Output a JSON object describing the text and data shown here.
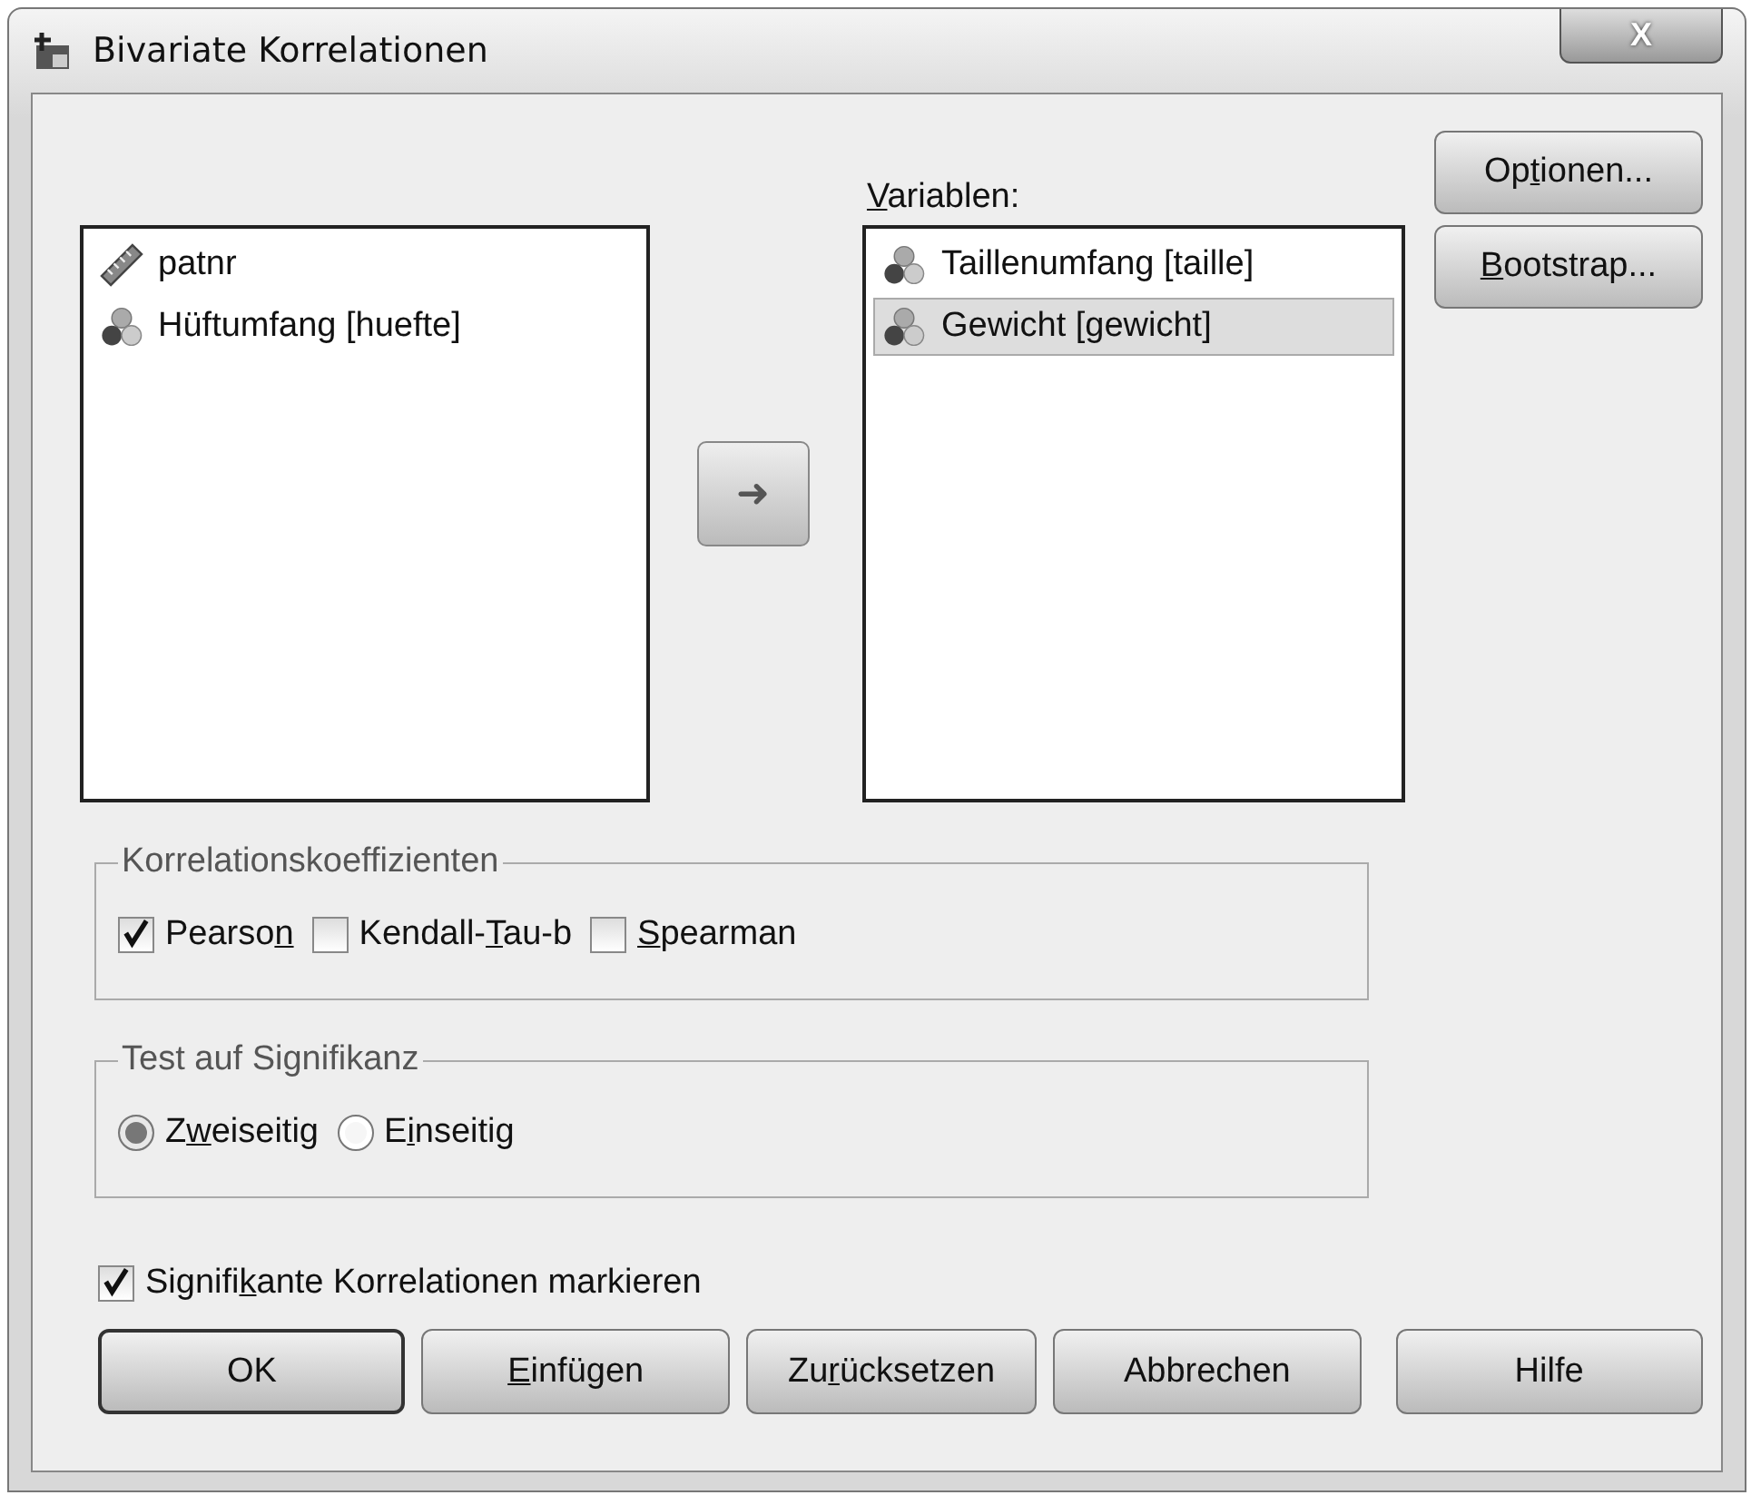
{
  "window": {
    "title": "Bivariate Korrelationen",
    "close_label": "X"
  },
  "source_list": {
    "items": [
      {
        "label": "patnr",
        "kind": "scale_ruler",
        "selected": false
      },
      {
        "label": "Hüftumfang [huefte]",
        "kind": "nominal",
        "selected": false
      }
    ]
  },
  "move_button": {
    "label": "➜"
  },
  "target_list": {
    "label": {
      "key": "V",
      "after": "ariablen:"
    },
    "items": [
      {
        "label": "Taillenumfang [taille]",
        "kind": "nominal",
        "selected": false
      },
      {
        "label": "Gewicht [gewicht]",
        "kind": "nominal",
        "selected": true
      }
    ]
  },
  "side_buttons": [
    {
      "label": {
        "before": "Op",
        "key": "t",
        "after": "ionen..."
      }
    },
    {
      "label": {
        "key": "B",
        "after": "ootstrap..."
      }
    }
  ],
  "coefficients": {
    "title": "Korrelationskoeffizienten",
    "options": [
      {
        "label": {
          "before": "Pearso",
          "key": "n"
        },
        "checked": true
      },
      {
        "label": {
          "before": "Kendall-",
          "key": "T",
          "after": "au-b"
        },
        "checked": false
      },
      {
        "label": {
          "key": "S",
          "after": "pearman"
        },
        "checked": false
      }
    ]
  },
  "significance": {
    "title": "Test auf Signifikanz",
    "options": [
      {
        "label": {
          "before": "Z",
          "key": "w",
          "after": "eiseitig"
        },
        "selected": true
      },
      {
        "label": {
          "before": "E",
          "key": "i",
          "after": "nseitig"
        },
        "selected": false
      }
    ]
  },
  "flag_significant": {
    "label": {
      "before": "Signifi",
      "key": "k",
      "after": "ante Korrelationen markieren"
    },
    "checked": true
  },
  "buttons": [
    {
      "label": {
        "before": "OK"
      },
      "default": true
    },
    {
      "label": {
        "key": "E",
        "after": "infügen"
      },
      "default": false
    },
    {
      "label": {
        "before": "Zu",
        "key": "r",
        "after": "ücksetzen"
      },
      "default": false
    },
    {
      "label": {
        "before": "Abbrechen"
      },
      "default": false
    },
    {
      "label": {
        "before": "Hilfe"
      },
      "default": false
    }
  ]
}
